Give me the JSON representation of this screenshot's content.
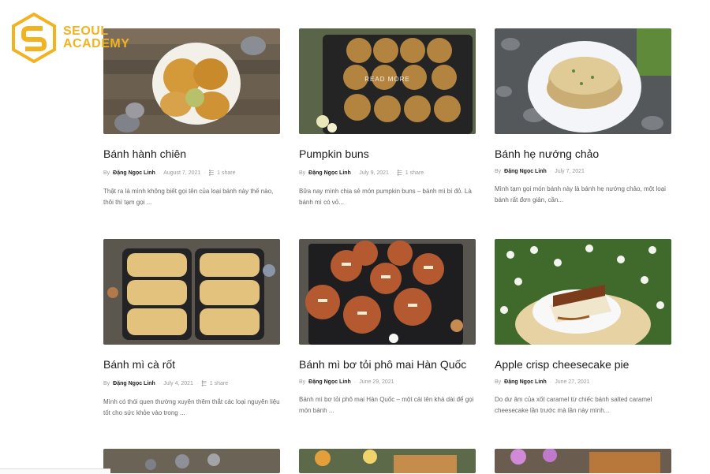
{
  "brand": {
    "line1": "SEOUL",
    "line2": "ACADEMY",
    "color": "#f2b320"
  },
  "read_more_label": "READ MORE",
  "posts": [
    {
      "title": "Bánh hành chiên",
      "by": "By",
      "author": "Đặng Ngọc Linh",
      "date": "August 7, 2021",
      "shares": "1 share",
      "excerpt": "Thật ra là mình không biết gọi tên của loại bánh này thế nào, thôi thì tạm gọi ..."
    },
    {
      "title": "Pumpkin buns",
      "by": "By",
      "author": "Đặng Ngọc Linh",
      "date": "July 9, 2021",
      "shares": "1 share",
      "excerpt": "Bữa nay mình chia sẻ món pumpkin buns – bánh mì bí đỏ. Là bánh mì có vỏ..."
    },
    {
      "title": "Bánh hẹ nướng chảo",
      "by": "By",
      "author": "Đặng Ngọc Linh",
      "date": "July 7, 2021",
      "shares": "",
      "excerpt": "Mình tạm gọi món bánh này là bánh hẹ nướng chảo, một loại bánh rất đơn giản, cần..."
    },
    {
      "title": "Bánh mì cà rốt",
      "by": "By",
      "author": "Đặng Ngọc Linh",
      "date": "July 4, 2021",
      "shares": "1 share",
      "excerpt": "Mình có thói quen thường xuyên thêm thắt các loại nguyên liệu tốt cho sức khỏe vào trong ..."
    },
    {
      "title": "Bánh mì bơ tỏi phô mai Hàn Quốc",
      "by": "By",
      "author": "Đặng Ngọc Linh",
      "date": "June 29, 2021",
      "shares": "",
      "excerpt": "Bánh mì bơ tỏi phô mai Hàn Quốc – một cái tên khá dài để gọi món bánh ..."
    },
    {
      "title": "Apple crisp cheesecake pie",
      "by": "By",
      "author": "Đặng Ngọc Linh",
      "date": "June 27, 2021",
      "shares": "",
      "excerpt": "Do dư âm của xốt caramel từ chiếc bánh salted caramel cheesecake lần trước mà lần này mình..."
    }
  ],
  "icons": {
    "share": "share-icon",
    "logo": "seoul-academy-logo-icon"
  }
}
